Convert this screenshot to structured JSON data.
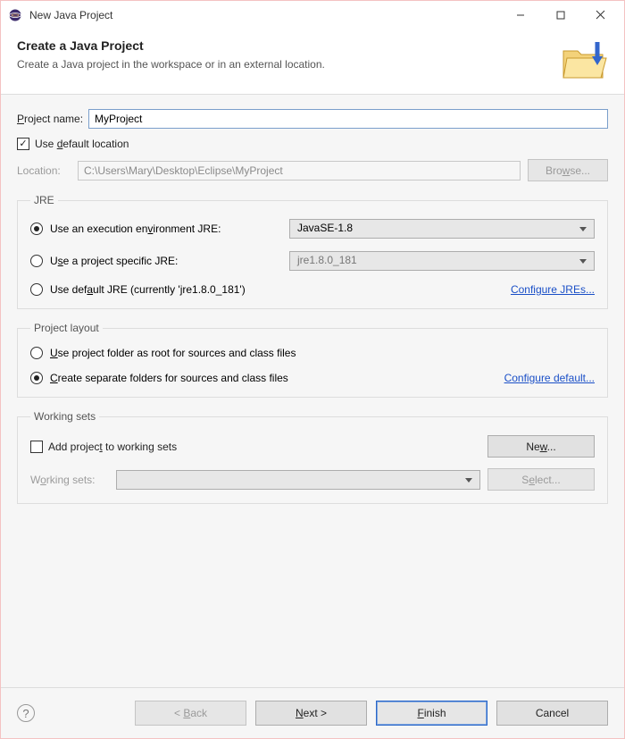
{
  "window": {
    "title": "New Java Project"
  },
  "header": {
    "title": "Create a Java Project",
    "desc": "Create a Java project in the workspace or in an external location."
  },
  "form": {
    "project_name_prefix": "P",
    "project_name_label": "roject name:",
    "project_name_value": "MyProject",
    "use_default_prefix": "Use ",
    "use_default_u": "d",
    "use_default_suffix": "efault location",
    "location_label": "Location:",
    "location_value": "C:\\Users\\Mary\\Desktop\\Eclipse\\MyProject",
    "browse_prefix": "Bro",
    "browse_u": "w",
    "browse_suffix": "se..."
  },
  "jre": {
    "legend": "JRE",
    "opt1_prefix": "Use an execution en",
    "opt1_u": "v",
    "opt1_suffix": "ironment JRE:",
    "opt1_value": "JavaSE-1.8",
    "opt2_prefix": "U",
    "opt2_u": "s",
    "opt2_suffix": "e a project specific JRE:",
    "opt2_value": "jre1.8.0_181",
    "opt3_prefix": "Use def",
    "opt3_u": "a",
    "opt3_suffix": "ult JRE (currently 'jre1.8.0_181')",
    "configure_prefix": "Configure JR",
    "configure_u": "E",
    "configure_suffix": "s..."
  },
  "layout": {
    "legend": "Project layout",
    "opt1_u": "U",
    "opt1_suffix": "se project folder as root for sources and class files",
    "opt2_u": "C",
    "opt2_suffix": "reate separate folders for sources and class files",
    "configure_prefix": "Configure de",
    "configure_u": "f",
    "configure_suffix": "ault..."
  },
  "working": {
    "legend": "Working sets",
    "check_prefix": "Add projec",
    "check_u": "t",
    "check_suffix": " to working sets",
    "new_prefix": "Ne",
    "new_u": "w",
    "new_suffix": "...",
    "label_prefix": "W",
    "label_u": "o",
    "label_suffix": "rking sets:",
    "select_prefix": "S",
    "select_u": "e",
    "select_suffix": "lect..."
  },
  "footer": {
    "back_lt": "< ",
    "back_u": "B",
    "back_suffix": "ack",
    "next_u": "N",
    "next_suffix": "ext >",
    "finish_u": "F",
    "finish_suffix": "inish",
    "cancel": "Cancel"
  }
}
